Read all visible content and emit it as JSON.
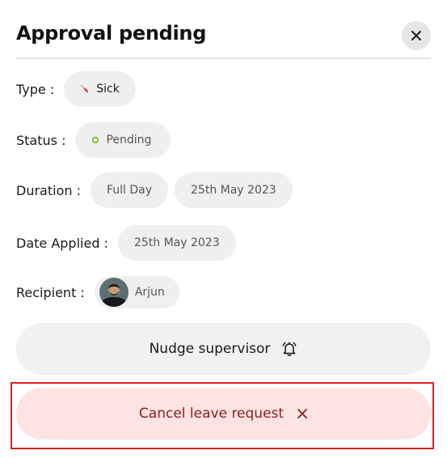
{
  "header": {
    "title": "Approval pending",
    "close_icon": "close-icon"
  },
  "details": {
    "type": {
      "label": "Type :",
      "value": "Sick",
      "icon": "thermometer-icon"
    },
    "status": {
      "label": "Status :",
      "value": "Pending",
      "icon": "status-dot-icon",
      "dot_color": "#7cb518"
    },
    "duration": {
      "label": "Duration :",
      "span": "Full Day",
      "date": "25th May 2023"
    },
    "date_applied": {
      "label": "Date Applied :",
      "date": "25th May 2023"
    },
    "recipient": {
      "label": "Recipient :",
      "name": "Arjun"
    }
  },
  "actions": {
    "nudge_label": "Nudge supervisor",
    "nudge_icon": "bell-icon",
    "cancel_label": "Cancel leave request",
    "cancel_icon": "close-icon"
  },
  "colors": {
    "cancel_bg": "#fde3e1",
    "cancel_text": "#8a2020",
    "highlight_border": "#e02020"
  }
}
